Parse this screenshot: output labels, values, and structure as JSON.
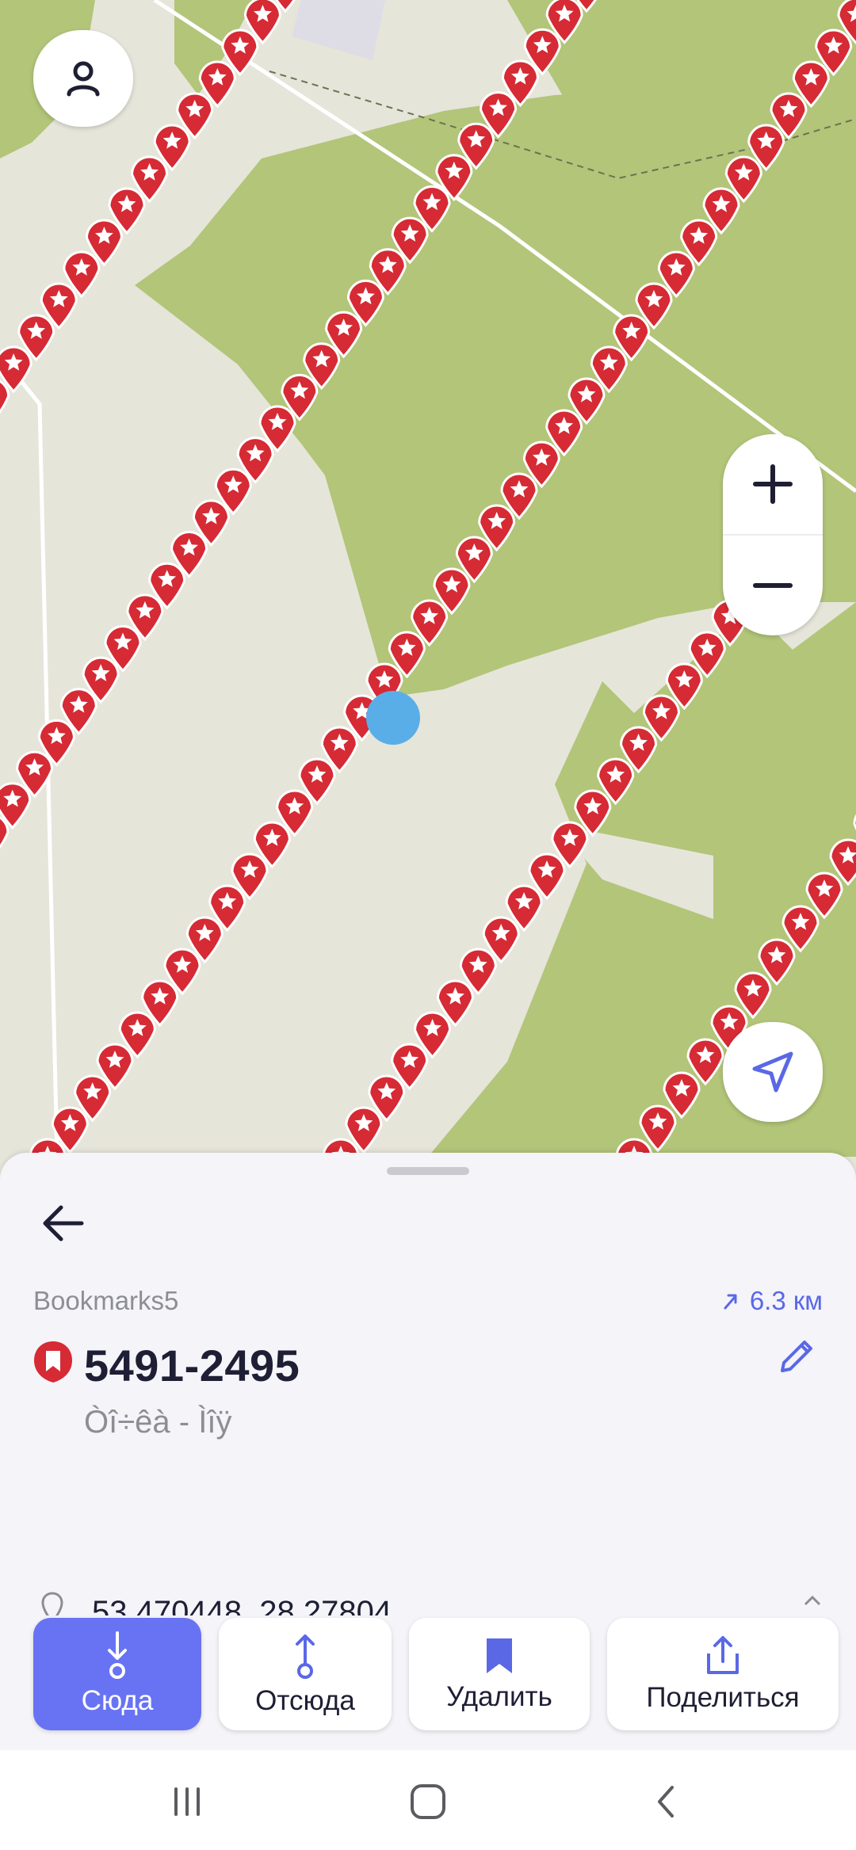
{
  "map": {
    "colors": {
      "land": "#e6e5da",
      "forest": "#b2c579",
      "marker": "#d62a35",
      "location": "#5aaee8"
    }
  },
  "controls": {
    "profile_icon": "person-icon",
    "zoom_in_icon": "plus-icon",
    "zoom_out_icon": "minus-icon",
    "navigate_icon": "navigation-arrow-icon"
  },
  "sheet": {
    "list_name": "Bookmarks5",
    "distance": "6.3 км",
    "title": "5491-2495",
    "subtitle": "Òî÷êà - Ìîÿ",
    "coordinates": "53.470448, 28.27804"
  },
  "actions": [
    {
      "label": "Сюда",
      "icon": "route-to-icon"
    },
    {
      "label": "Отсюда",
      "icon": "route-from-icon"
    },
    {
      "label": "Удалить",
      "icon": "bookmark-icon"
    },
    {
      "label": "Поделиться",
      "icon": "share-icon"
    }
  ],
  "system_nav": [
    "recent-apps-icon",
    "home-icon",
    "back-icon"
  ]
}
